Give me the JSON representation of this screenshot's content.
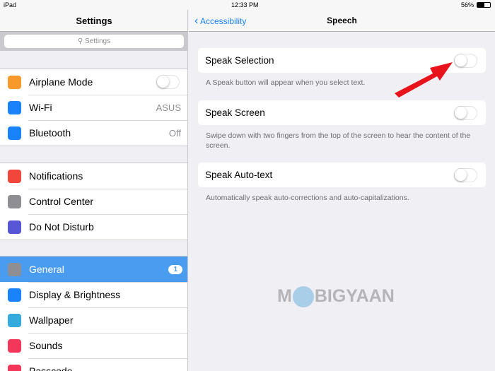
{
  "status": {
    "device": "iPad",
    "time": "12:33 PM",
    "battery": "56%"
  },
  "sidebar": {
    "title": "Settings",
    "search_placeholder": "Settings",
    "groups": [
      [
        {
          "label": "Airplane Mode",
          "icon": "airplane-icon",
          "color": "#f79a2b",
          "toggle": false
        },
        {
          "label": "Wi-Fi",
          "icon": "wifi-icon",
          "color": "#1a82fb",
          "value": "ASUS"
        },
        {
          "label": "Bluetooth",
          "icon": "bluetooth-icon",
          "color": "#1a82fb",
          "value": "Off"
        }
      ],
      [
        {
          "label": "Notifications",
          "icon": "notifications-icon",
          "color": "#f2463d"
        },
        {
          "label": "Control Center",
          "icon": "control-center-icon",
          "color": "#8e8e93"
        },
        {
          "label": "Do Not Disturb",
          "icon": "moon-icon",
          "color": "#5856d6"
        }
      ],
      [
        {
          "label": "General",
          "icon": "gear-icon",
          "color": "#8e8e93",
          "badge": "1",
          "selected": true
        },
        {
          "label": "Display & Brightness",
          "icon": "display-icon",
          "color": "#1a82fb"
        },
        {
          "label": "Wallpaper",
          "icon": "wallpaper-icon",
          "color": "#35aadc"
        },
        {
          "label": "Sounds",
          "icon": "sounds-icon",
          "color": "#f2375a"
        },
        {
          "label": "Passcode",
          "icon": "lock-icon",
          "color": "#f2375a"
        }
      ]
    ]
  },
  "detail": {
    "back_label": "Accessibility",
    "title": "Speech",
    "items": [
      {
        "label": "Speak Selection",
        "footer": "A Speak button will appear when you select text.",
        "toggle": false
      },
      {
        "label": "Speak Screen",
        "footer": "Swipe down with two fingers from the top of the screen to hear the content of the screen.",
        "toggle": false
      },
      {
        "label": "Speak Auto-text",
        "footer": "Automatically speak auto-corrections and auto-capitalizations.",
        "toggle": false
      }
    ]
  },
  "watermark": "MOBIGYAAN",
  "colors": {
    "accent": "#1a82fb",
    "selected": "#4a9cf1",
    "arrow": "#e8141b"
  }
}
